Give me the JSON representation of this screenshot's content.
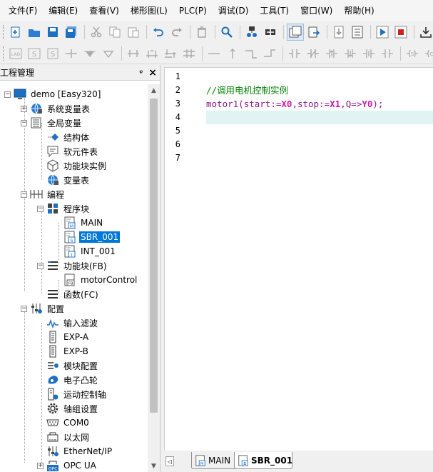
{
  "menubar": {
    "items": [
      "文件(F)",
      "编辑(E)",
      "查看(V)",
      "梯形图(L)",
      "PLC(P)",
      "调试(D)",
      "工具(T)",
      "窗口(W)",
      "帮助(H)"
    ]
  },
  "toolbar1": {
    "icons": [
      "new-file-icon",
      "open-folder-icon",
      "save-icon",
      "save-all-icon",
      "cut-icon",
      "copy-icon",
      "paste-icon",
      "undo-icon",
      "redo-icon",
      "delete-icon",
      "search-icon",
      "network-icon",
      "add-device-icon",
      "window-icon",
      "export-icon",
      "download-icon",
      "compare-icon",
      "run-icon",
      "stop-icon",
      "upload-icon"
    ]
  },
  "toolbar2": {
    "icons": [
      "lad-icon",
      "il-icon",
      "st-icon",
      "contact-icon",
      "coil-down-icon",
      "coil-outline-icon",
      "branch-icon",
      "branch-2-icon",
      "branch-3-icon",
      "branch-4-icon",
      "hline-icon",
      "vline-up-icon",
      "corner-icon",
      "corner-2-icon",
      "no-contact-icon",
      "nc-contact-icon",
      "rise-contact-icon",
      "fall-contact-icon",
      "pulse-contact-icon",
      "invert-contact-icon",
      "set-icon",
      "reset-icon"
    ]
  },
  "panel": {
    "title": "工程管理",
    "pin": "ᵠ",
    "close": "×"
  },
  "tree": {
    "root": "demo [Easy320]",
    "system_vars": "系统变量表",
    "global_vars": "全局变量",
    "struct": "结构体",
    "soft_elements": "软元件表",
    "fb_instances": "功能块实例",
    "var_table": "变量表",
    "programming": "编程",
    "program_blocks": "程序块",
    "main": "MAIN",
    "sbr_001": "SBR_001",
    "int_001": "INT_001",
    "function_blocks": "功能块(FB)",
    "motor_control": "motorControl",
    "functions": "函数(FC)",
    "config": "配置",
    "input_filter": "输入滤波",
    "exp_a": "EXP-A",
    "exp_b": "EXP-B",
    "module_config": "模块配置",
    "e_cam": "电子凸轮",
    "motion_axis": "运动控制轴",
    "axis_group": "轴组设置",
    "com0": "COM0",
    "ethernet": "以太网",
    "ethernet_ip": "EtherNet/IP",
    "opc_ua": "OPC UA"
  },
  "editor": {
    "line_numbers": [
      "1",
      "2",
      "3",
      "4",
      "5",
      "6",
      "7"
    ],
    "line2_comment": "//调用电机控制实例",
    "line3": {
      "fb": "motor1",
      "open": "(",
      "p1": "start",
      "assign1": ":=",
      "v1": "X0",
      "comma1": ",",
      "p2": "stop",
      "assign2": ":=",
      "v2": "X1",
      "comma2": ",",
      "p3": "Q",
      "arrow": "=>",
      "v3": "Y0",
      "close": ");"
    }
  },
  "tabs": {
    "scroll_left": "◁",
    "main": "MAIN",
    "sbr": "SBR_001"
  },
  "colors": {
    "selection": "#0078d7",
    "comment": "#008000",
    "current_line": "#e0f4f4"
  }
}
